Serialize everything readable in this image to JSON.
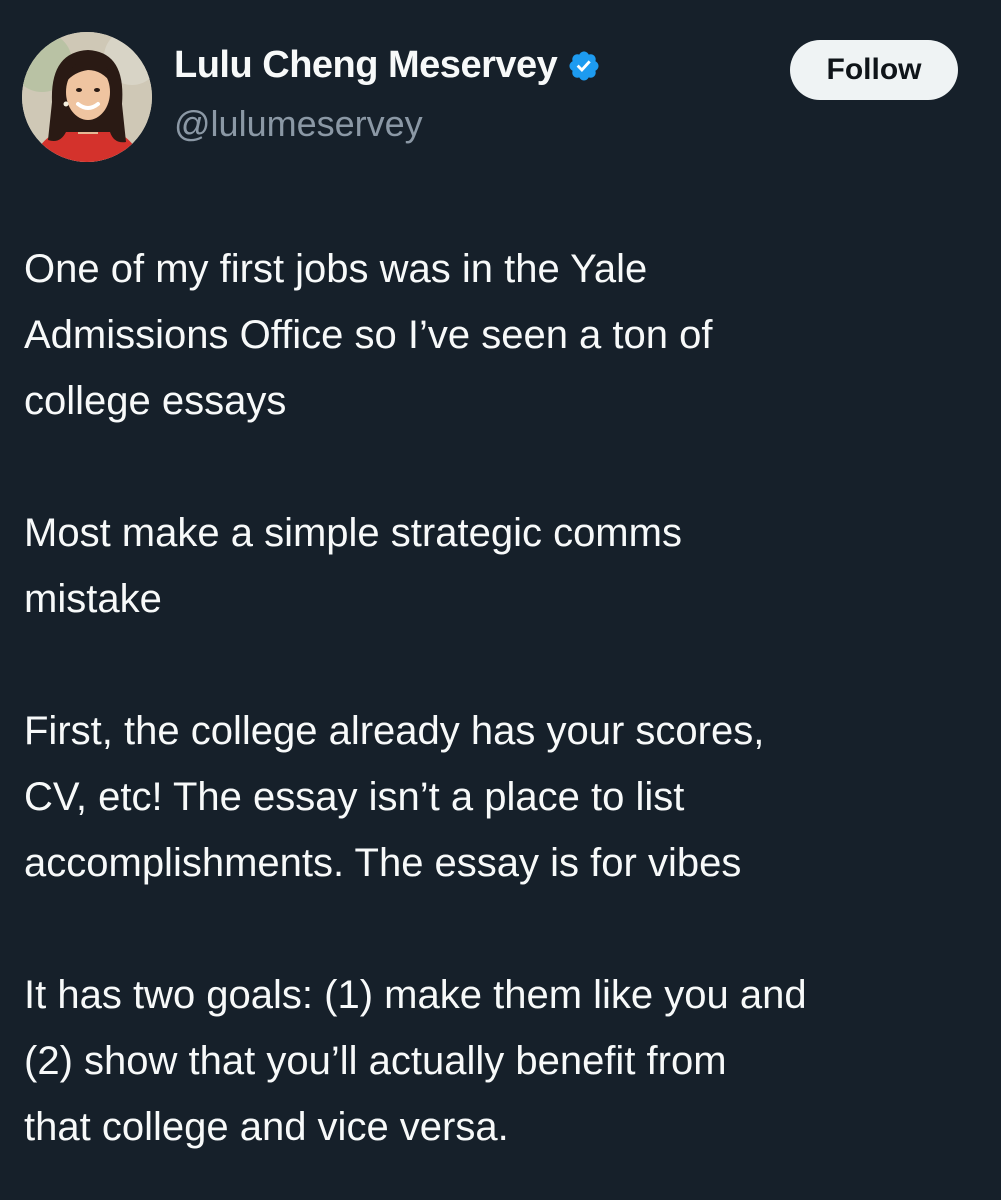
{
  "author": {
    "display_name": "Lulu Cheng Meservey",
    "handle": "@lulumeservey",
    "verified": true,
    "avatar_icon": "profile-photo"
  },
  "follow_button": {
    "label": "Follow"
  },
  "tweet": {
    "paragraphs": [
      {
        "lines": [
          "One of my first jobs was in the Yale",
          "Admissions Office so I’ve seen a ton of",
          "college essays"
        ]
      },
      {
        "lines": [
          "Most make a simple strategic comms",
          "mistake"
        ]
      },
      {
        "lines": [
          "First, the college already has your scores,",
          "CV, etc! The essay isn’t a place to list",
          "accomplishments. The essay is for vibes"
        ]
      },
      {
        "lines": [
          "It has two goals: (1) make them like you and",
          "(2) show that you’ll actually benefit from",
          "that college and vice versa."
        ]
      }
    ]
  },
  "colors": {
    "background": "#16202a",
    "text_primary": "#f7f9f9",
    "text_secondary": "#8b98a5",
    "verified_badge": "#1d9bf0",
    "follow_button_bg": "#eff3f4",
    "follow_button_text": "#0f1419"
  }
}
